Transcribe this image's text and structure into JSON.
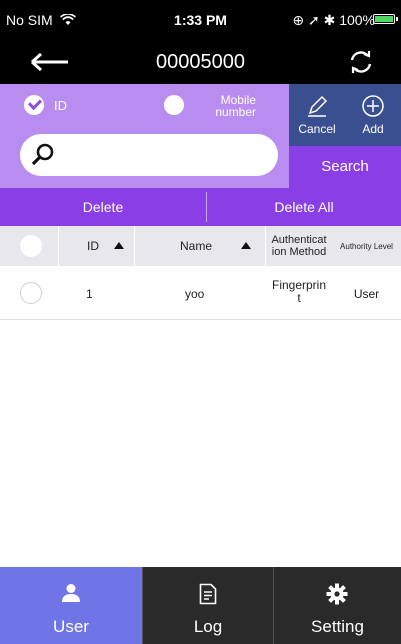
{
  "status_bar": {
    "carrier": "No SIM",
    "time": "1:33 PM",
    "battery": "100%"
  },
  "nav": {
    "title": "00005000",
    "back_icon": "arrow-left-icon",
    "refresh_icon": "refresh-icon"
  },
  "search": {
    "option_id": "ID",
    "option_mobile_line1": "Mobile",
    "option_mobile_line2": "number",
    "selected": "ID",
    "query": "",
    "search_label": "Search"
  },
  "actions": {
    "cancel_label": "Cancel",
    "add_label": "Add"
  },
  "delete_bar": {
    "delete_label": "Delete",
    "delete_all_label": "Delete All"
  },
  "table": {
    "columns": {
      "id": "ID",
      "name": "Name",
      "auth_method_line1": "Authenticat",
      "auth_method_line2": "ion Method",
      "authority_level": "Authority Level"
    },
    "rows": [
      {
        "id": "1",
        "name": "yoo",
        "auth_method_line1": "Fingerprin",
        "auth_method_line2": "t",
        "authority_level": "User"
      }
    ]
  },
  "tabs": [
    {
      "label": "User",
      "icon": "user-icon",
      "active": true
    },
    {
      "label": "Log",
      "icon": "document-icon",
      "active": false
    },
    {
      "label": "Setting",
      "icon": "gear-icon",
      "active": false
    }
  ],
  "colors": {
    "purple_light": "#b98cf0",
    "purple": "#8a3ee6",
    "navy": "#3a4f8f",
    "tab_active": "#6f74e6"
  }
}
